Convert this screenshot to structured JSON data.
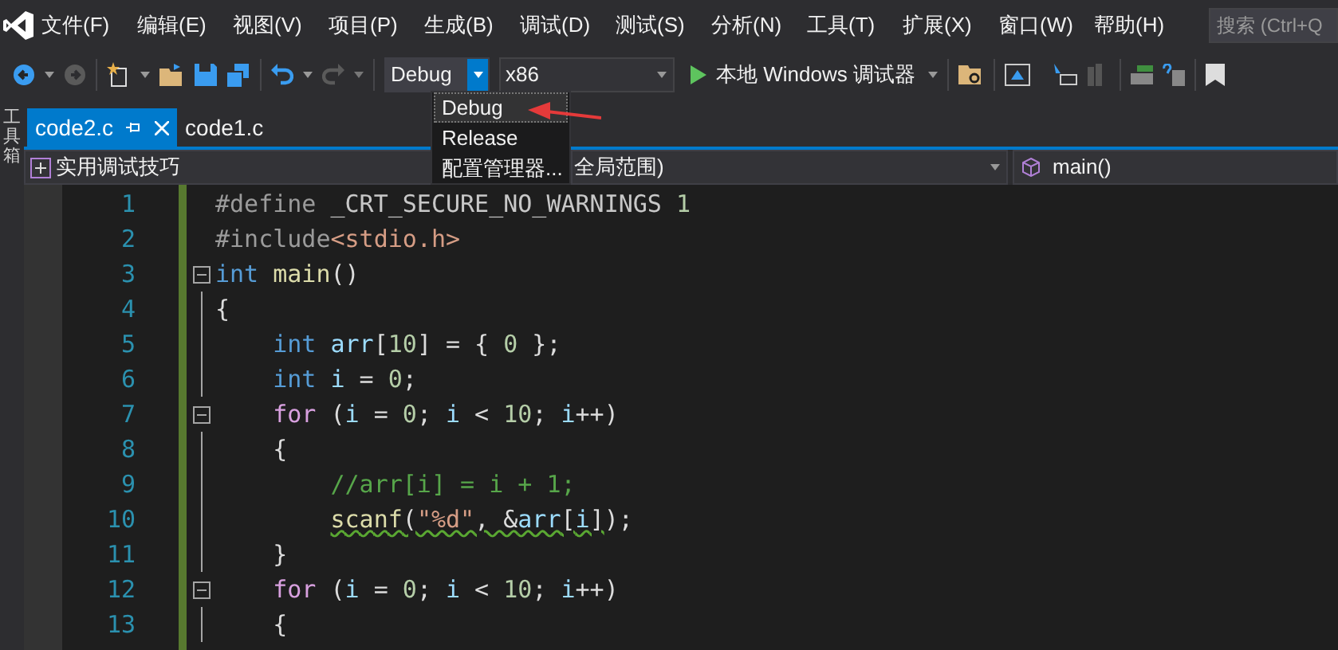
{
  "menu_bar": {
    "items": [
      "文件(F)",
      "编辑(E)",
      "视图(V)",
      "项目(P)",
      "生成(B)",
      "调试(D)",
      "测试(S)",
      "分析(N)",
      "工具(T)",
      "扩展(X)",
      "窗口(W)",
      "帮助(H)"
    ],
    "search": {
      "placeholder": "搜索 (Ctrl+Q"
    }
  },
  "toolbar": {
    "configuration": {
      "value": "Debug",
      "expanded": true,
      "options": [
        {
          "label": "Debug",
          "selected": true
        },
        {
          "label": "Release",
          "selected": false
        },
        {
          "label": "配置管理器...",
          "selected": false
        }
      ]
    },
    "platform": {
      "value": "x86"
    },
    "run_button": {
      "label": "本地 Windows 调试器"
    }
  },
  "side_strip": {
    "label": "工具箱"
  },
  "tabs": [
    {
      "label": "code2.c",
      "selected": true
    },
    {
      "label": "code1.c",
      "selected": false
    }
  ],
  "nav_bar": {
    "project": "实用调试技巧",
    "scope": "全局范围)",
    "member": "main()"
  },
  "editor": {
    "lines": [
      {
        "number": "1",
        "fold": false,
        "tokens": [
          {
            "kind": "pre",
            "text": "#define "
          },
          {
            "kind": "macro",
            "text": "_CRT_SECURE_NO_WARNINGS"
          },
          {
            "kind": "num",
            "text": " 1"
          }
        ]
      },
      {
        "number": "2",
        "fold": false,
        "tokens": [
          {
            "kind": "pre",
            "text": "#include"
          },
          {
            "kind": "str",
            "text": "<stdio.h>"
          }
        ]
      },
      {
        "number": "3",
        "fold": true,
        "tokens": [
          {
            "kind": "kw",
            "text": "int"
          },
          {
            "kind": "fn",
            "text": " main"
          },
          {
            "kind": "plain",
            "text": "()"
          }
        ]
      },
      {
        "number": "4",
        "fold": false,
        "tokens": [
          {
            "kind": "plain",
            "text": "{"
          }
        ]
      },
      {
        "number": "5",
        "fold": false,
        "tokens": [
          {
            "kind": "kw",
            "text": "    int"
          },
          {
            "kind": "var",
            "text": " arr"
          },
          {
            "kind": "plain",
            "text": "["
          },
          {
            "kind": "num",
            "text": "10"
          },
          {
            "kind": "plain",
            "text": "] = { "
          },
          {
            "kind": "num",
            "text": "0"
          },
          {
            "kind": "plain",
            "text": " };"
          }
        ]
      },
      {
        "number": "6",
        "fold": false,
        "tokens": [
          {
            "kind": "kw",
            "text": "    int"
          },
          {
            "kind": "var",
            "text": " i"
          },
          {
            "kind": "plain",
            "text": " = "
          },
          {
            "kind": "num",
            "text": "0"
          },
          {
            "kind": "plain",
            "text": ";"
          }
        ]
      },
      {
        "number": "7",
        "fold": true,
        "tokens": [
          {
            "kind": "kw2",
            "text": "    for"
          },
          {
            "kind": "plain",
            "text": " ("
          },
          {
            "kind": "var",
            "text": "i"
          },
          {
            "kind": "plain",
            "text": " = "
          },
          {
            "kind": "num",
            "text": "0"
          },
          {
            "kind": "plain",
            "text": "; "
          },
          {
            "kind": "var",
            "text": "i"
          },
          {
            "kind": "plain",
            "text": " < "
          },
          {
            "kind": "num",
            "text": "10"
          },
          {
            "kind": "plain",
            "text": "; "
          },
          {
            "kind": "var",
            "text": "i"
          },
          {
            "kind": "plain",
            "text": "++)"
          }
        ]
      },
      {
        "number": "8",
        "fold": false,
        "tokens": [
          {
            "kind": "plain",
            "text": "    {"
          }
        ]
      },
      {
        "number": "9",
        "fold": false,
        "tokens": [
          {
            "kind": "comment",
            "text": "        //arr[i] = i + 1;"
          }
        ]
      },
      {
        "number": "10",
        "fold": false,
        "tokens": [
          {
            "kind": "fn",
            "text": "        scanf",
            "squiggle": true
          },
          {
            "kind": "plain",
            "text": "(",
            "squiggle": true
          },
          {
            "kind": "str",
            "text": "\"%d\"",
            "squiggle": true
          },
          {
            "kind": "plain",
            "text": ", &",
            "squiggle": true
          },
          {
            "kind": "var",
            "text": "arr",
            "squiggle": true
          },
          {
            "kind": "plain",
            "text": "[",
            "squiggle": true
          },
          {
            "kind": "var",
            "text": "i",
            "squiggle": true
          },
          {
            "kind": "plain",
            "text": "]",
            "squiggle": true
          },
          {
            "kind": "plain",
            "text": ");"
          }
        ]
      },
      {
        "number": "11",
        "fold": false,
        "tokens": [
          {
            "kind": "plain",
            "text": "    }"
          }
        ]
      },
      {
        "number": "12",
        "fold": true,
        "tokens": [
          {
            "kind": "kw2",
            "text": "    for"
          },
          {
            "kind": "plain",
            "text": " ("
          },
          {
            "kind": "var",
            "text": "i"
          },
          {
            "kind": "plain",
            "text": " = "
          },
          {
            "kind": "num",
            "text": "0"
          },
          {
            "kind": "plain",
            "text": "; "
          },
          {
            "kind": "var",
            "text": "i"
          },
          {
            "kind": "plain",
            "text": " < "
          },
          {
            "kind": "num",
            "text": "10"
          },
          {
            "kind": "plain",
            "text": "; "
          },
          {
            "kind": "var",
            "text": "i"
          },
          {
            "kind": "plain",
            "text": "++)"
          }
        ]
      },
      {
        "number": "13",
        "fold": false,
        "tokens": [
          {
            "kind": "plain",
            "text": "    {"
          }
        ]
      }
    ]
  }
}
